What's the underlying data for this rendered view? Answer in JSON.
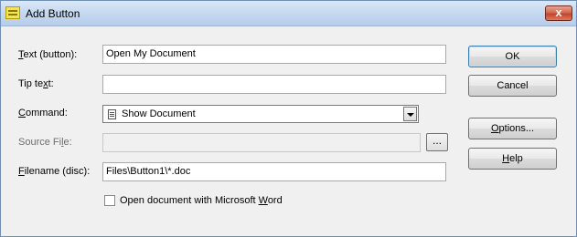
{
  "window": {
    "title": "Add Button",
    "close_label": "x"
  },
  "form": {
    "text_label_prefix": "T",
    "text_label_rest": "ext (button):",
    "text_value": "Open My Document",
    "tip_label_prefix": "Tip te",
    "tip_label_u": "x",
    "tip_label_rest": "t:",
    "tip_value": "",
    "command_label_prefix": "C",
    "command_label_rest": "ommand:",
    "command_value": "Show Document",
    "source_label_prefix": "Source Fi",
    "source_label_u": "l",
    "source_label_rest": "e:",
    "source_value": "",
    "browse_label": "...",
    "filename_label_prefix": "F",
    "filename_label_rest": "ilename (disc):",
    "filename_value": "Files\\Button1\\*.doc",
    "checkbox_prefix": "Open document with Microsoft ",
    "checkbox_u": "W",
    "checkbox_rest": "ord",
    "checkbox_checked": false
  },
  "buttons": {
    "ok": "OK",
    "cancel": "Cancel",
    "options_u": "O",
    "options_rest": "ptions...",
    "help_u": "H",
    "help_rest": "elp"
  }
}
